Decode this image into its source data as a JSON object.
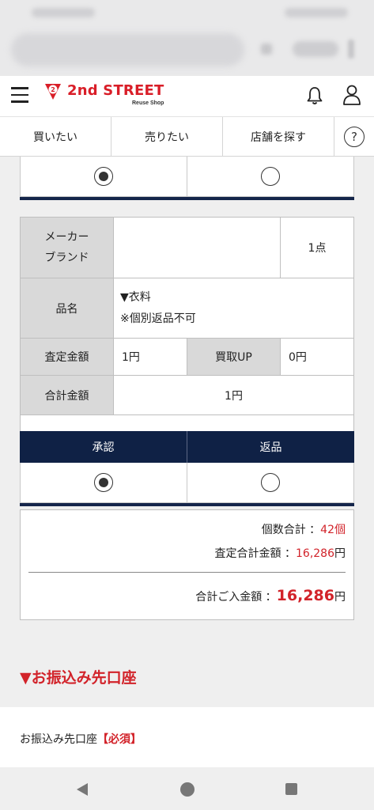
{
  "header": {
    "brand": "2nd STREET",
    "brand_sub": "Reuse Shop"
  },
  "nav": {
    "items": [
      {
        "label": "買いたい"
      },
      {
        "label": "売りたい"
      },
      {
        "label": "店舗を探す"
      }
    ],
    "help": "?"
  },
  "item_table": {
    "maker_label": "メーカー\nブランド",
    "maker_value": "",
    "quantity": "1点",
    "name_label": "品名",
    "name_line1": "▼衣料",
    "name_line2": "※個別返品不可",
    "appraisal_label": "査定金額",
    "appraisal_value": "1円",
    "bonus_label": "買取UP",
    "bonus_value": "0円",
    "subtotal_label": "合計金額",
    "subtotal_value": "1円"
  },
  "actions": {
    "approve_label": "承認",
    "return_label": "返品",
    "selected": "approve"
  },
  "summary": {
    "count_label": "個数合計 ：",
    "count_value": "42個",
    "appraisal_total_label": "査定合計金額 ：",
    "appraisal_total_value": "16,286",
    "appraisal_total_unit": "円",
    "deposit_label": "合計ご入金額 ：",
    "deposit_value": "16,286",
    "deposit_unit": "円"
  },
  "transfer": {
    "section_title": "▼お振込み先口座",
    "field_label": "お振込み先口座",
    "required": "【必須】"
  },
  "colors": {
    "brand_red": "#d91e28",
    "navy": "#0f2145",
    "price_red": "#d2232a"
  }
}
